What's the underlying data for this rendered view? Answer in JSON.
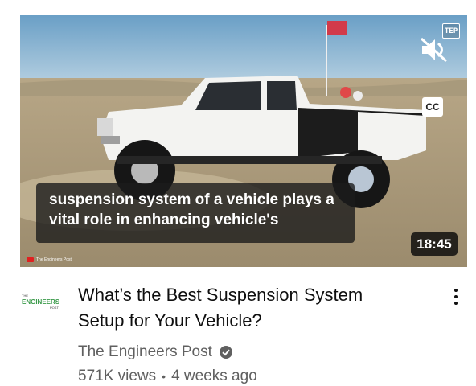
{
  "video": {
    "caption_lines": [
      "suspension system of a vehicle plays a",
      "vital role in enhancing vehicle's"
    ],
    "duration": "18:45",
    "badge": "TEP",
    "cc_label": "CC",
    "watermark": "The Engineers Post",
    "icons": [
      "mute-icon",
      "closed-captions-icon",
      "verified-icon",
      "more-options-icon"
    ]
  },
  "details": {
    "title_lines": [
      "What’s the Best Suspension System",
      "Setup for Your Vehicle?"
    ],
    "channel": "The Engineers Post",
    "views": "571K views",
    "separator": "•",
    "age": "4 weeks ago",
    "avatar_text_top": "THE",
    "avatar_text_main": "ENGINEERS",
    "avatar_text_bottom": "POST"
  },
  "colors": {
    "text_primary": "#0f0f0f",
    "text_secondary": "#606060",
    "brand_green": "#3a9a4a"
  }
}
